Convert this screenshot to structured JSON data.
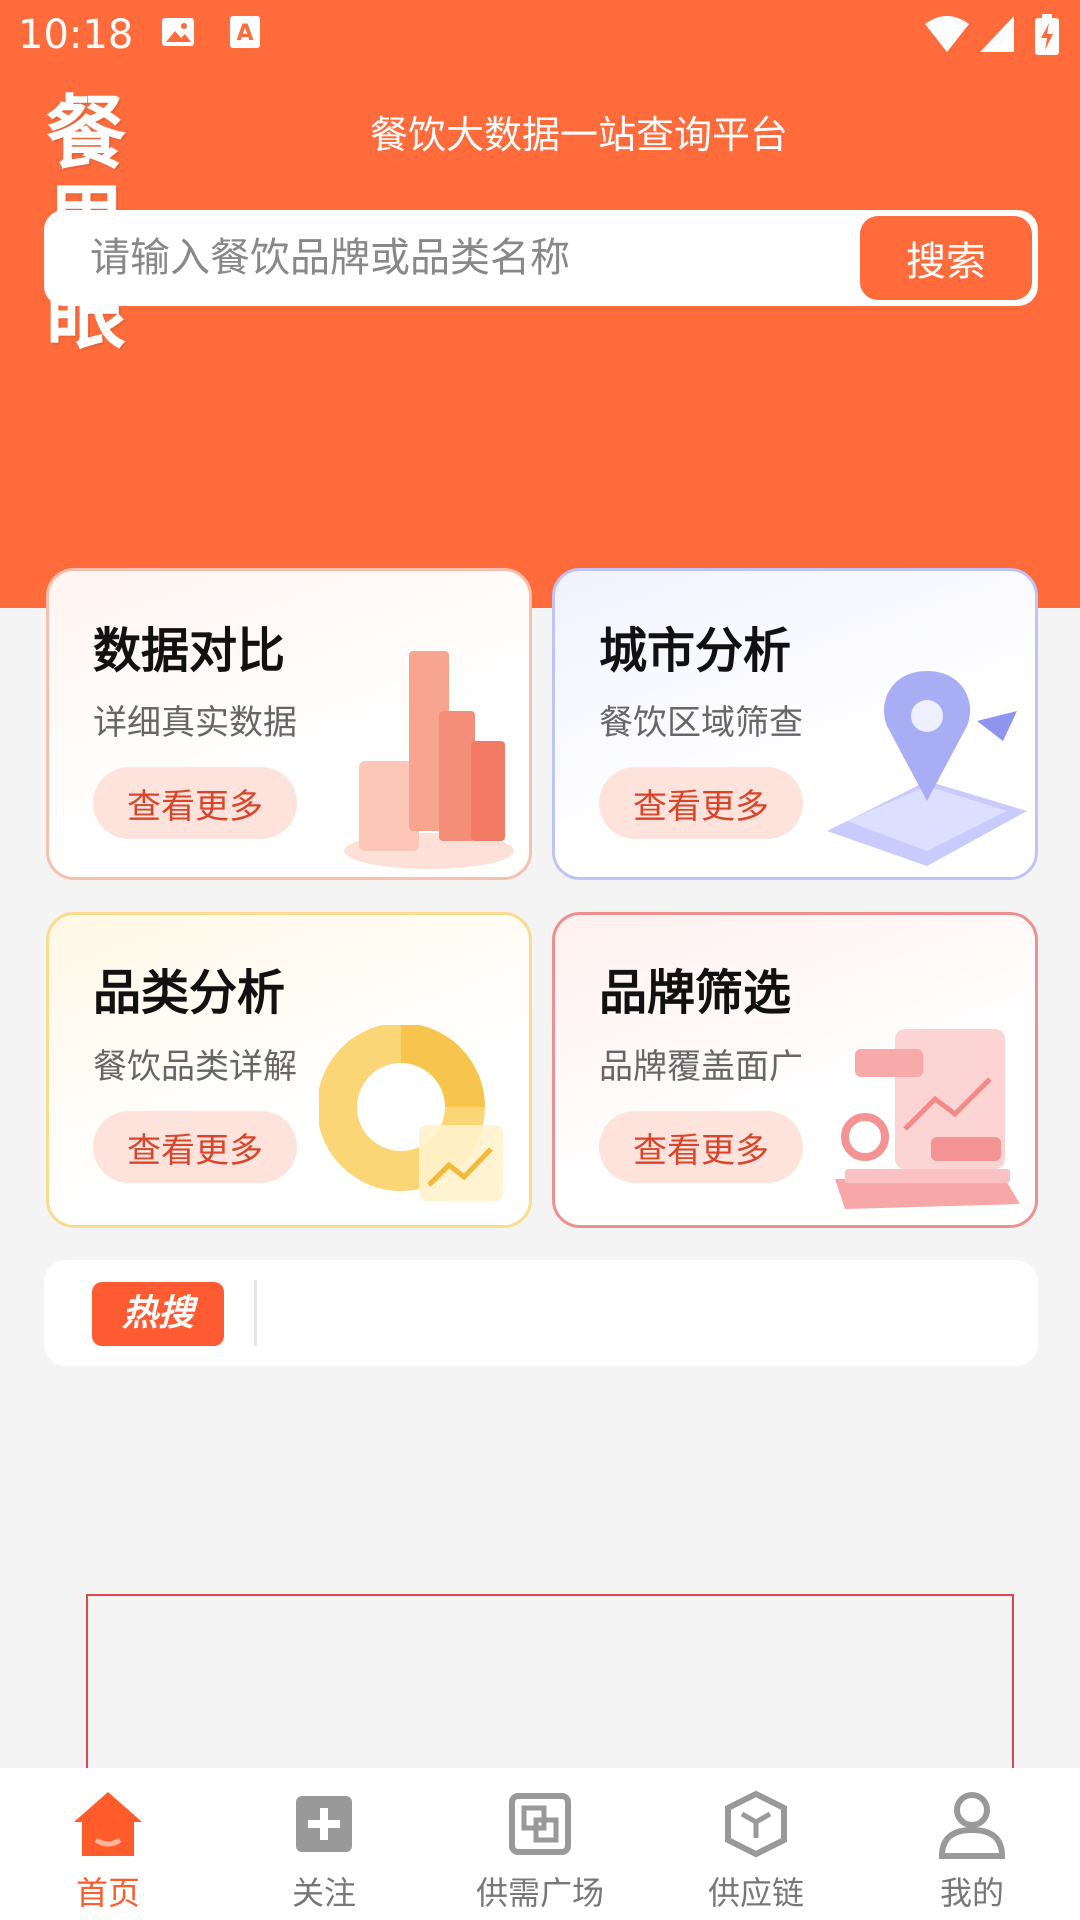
{
  "status_bar": {
    "time": "10:18",
    "icons": [
      "image-icon",
      "a-icon",
      "wifi-icon",
      "signal-icon",
      "battery-charging-icon"
    ]
  },
  "header": {
    "brand_name": "餐里眼",
    "tagline": "餐饮大数据一站查询平台",
    "search": {
      "placeholder": "请输入餐饮品牌或品类名称",
      "button_label": "搜索"
    },
    "background_color": "#ff6b3b"
  },
  "cards": [
    {
      "title": "数据对比",
      "subtitle": "详细真实数据",
      "button": "查看更多",
      "accent": "#f4b6a6",
      "illustration": "bar-chart-icon"
    },
    {
      "title": "城市分析",
      "subtitle": "餐饮区域筛查",
      "button": "查看更多",
      "accent": "#b9bdf4",
      "illustration": "map-pin-icon"
    },
    {
      "title": "品类分析",
      "subtitle": "餐饮品类详解",
      "button": "查看更多",
      "accent": "#f8d98a",
      "illustration": "donut-chart-icon"
    },
    {
      "title": "品牌筛选",
      "subtitle": "品牌覆盖面广",
      "button": "查看更多",
      "accent": "#ef9a9a",
      "illustration": "dashboard-icon"
    }
  ],
  "hot_search": {
    "badge": "热搜"
  },
  "tabbar": {
    "items": [
      {
        "label": "首页",
        "icon": "home-icon",
        "active": true
      },
      {
        "label": "关注",
        "icon": "plus-square-icon",
        "active": false
      },
      {
        "label": "供需广场",
        "icon": "squares-icon",
        "active": false
      },
      {
        "label": "供应链",
        "icon": "cube-icon",
        "active": false
      },
      {
        "label": "我的",
        "icon": "user-icon",
        "active": false
      }
    ],
    "active_color": "#ff5b2b"
  }
}
